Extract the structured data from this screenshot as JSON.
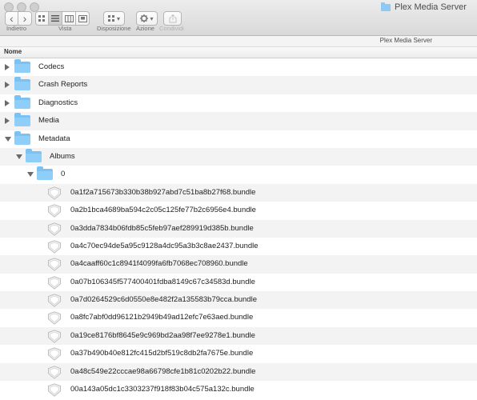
{
  "window": {
    "title": "Plex Media Server"
  },
  "toolbar": {
    "back_label": "Indietro",
    "view_label": "Vista",
    "arrange_label": "Disposizione",
    "action_label": "Azione",
    "share_label": "Condividi",
    "back_glyph": "‹",
    "forward_glyph": "›",
    "dropdown_glyph": "▾",
    "active_view": "list"
  },
  "pathbar": {
    "title": "Plex Media Server"
  },
  "columns": {
    "name": "Nome"
  },
  "rows": [
    {
      "label": "Codecs",
      "kind": "folder",
      "level": 0,
      "expanded": false
    },
    {
      "label": "Crash Reports",
      "kind": "folder",
      "level": 0,
      "expanded": false
    },
    {
      "label": "Diagnostics",
      "kind": "folder",
      "level": 0,
      "expanded": false
    },
    {
      "label": "Media",
      "kind": "folder",
      "level": 0,
      "expanded": false
    },
    {
      "label": "Metadata",
      "kind": "folder",
      "level": 0,
      "expanded": true
    },
    {
      "label": "Albums",
      "kind": "folder",
      "level": 1,
      "expanded": true
    },
    {
      "label": "0",
      "kind": "folder",
      "level": 2,
      "expanded": true
    },
    {
      "label": "0a1f2a715673b330b38b927abd7c51ba8b27f68.bundle",
      "kind": "bundle",
      "level": 3
    },
    {
      "label": "0a2b1bca4689ba594c2c05c125fe77b2c6956e4.bundle",
      "kind": "bundle",
      "level": 3
    },
    {
      "label": "0a3dda7834b06fdb85c5feb97aef289919d385b.bundle",
      "kind": "bundle",
      "level": 3
    },
    {
      "label": "0a4c70ec94de5a95c9128a4dc95a3b3c8ae2437.bundle",
      "kind": "bundle",
      "level": 3
    },
    {
      "label": "0a4caaff60c1c8941f4099fa6fb7068ec708960.bundle",
      "kind": "bundle",
      "level": 3
    },
    {
      "label": "0a07b106345f577400401fdba8149c67c34583d.bundle",
      "kind": "bundle",
      "level": 3
    },
    {
      "label": "0a7d0264529c6d0550e8e482f2a135583b79cca.bundle",
      "kind": "bundle",
      "level": 3
    },
    {
      "label": "0a8fc7abf0dd96121b2949b49ad12efc7e63aed.bundle",
      "kind": "bundle",
      "level": 3
    },
    {
      "label": "0a19ce8176bf8645e9c969bd2aa98f7ee9278e1.bundle",
      "kind": "bundle",
      "level": 3
    },
    {
      "label": "0a37b490b40e812fc415d2bf519c8db2fa7675e.bundle",
      "kind": "bundle",
      "level": 3
    },
    {
      "label": "0a48c549e22cccae98a66798cfe1b81c0202b22.bundle",
      "kind": "bundle",
      "level": 3
    },
    {
      "label": "00a143a05dc1c3303237f918f83b04c575a132c.bundle",
      "kind": "bundle",
      "level": 3
    }
  ],
  "colors": {
    "folder": "#7bc2f4",
    "row_alt": "#f3f3f3"
  }
}
